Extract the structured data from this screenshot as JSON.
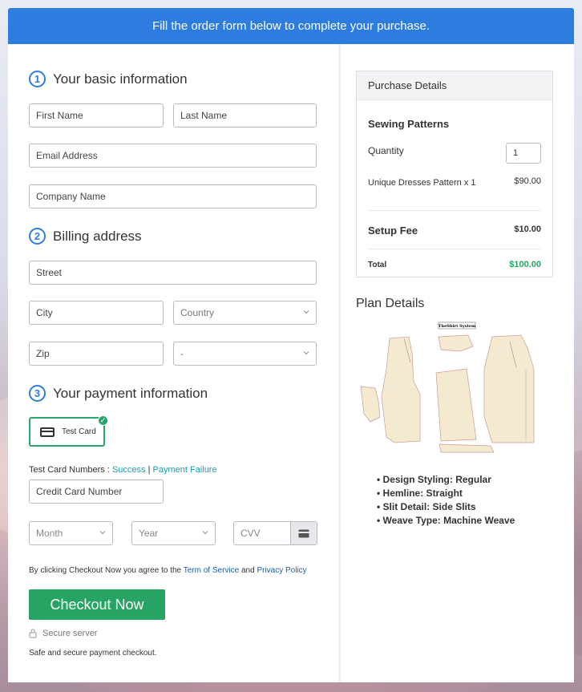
{
  "banner": "Fill the order form below to complete your purchase.",
  "sections": {
    "basic": {
      "num": "1",
      "title": "Your basic information"
    },
    "billing": {
      "num": "2",
      "title": "Billing address"
    },
    "payment": {
      "num": "3",
      "title": "Your payment information"
    }
  },
  "fields": {
    "first_name": "First Name",
    "last_name": "Last Name",
    "email": "Email Address",
    "company": "Company Name",
    "street": "Street",
    "city": "City",
    "country": "Country",
    "zip": "Zip",
    "state": "-",
    "card_number": "Credit Card Number",
    "month": "Month",
    "year": "Year",
    "cvv": "CVV"
  },
  "payment": {
    "test_card_label": "Test Card",
    "test_numbers_label": "Test Card Numbers :",
    "success_link": "Success",
    "separator": "|",
    "failure_link": "Payment Failure"
  },
  "terms": {
    "prefix": "By clicking Checkout Now you agree to the",
    "tos": "Term of Service",
    "and": "and",
    "privacy": "Privacy Policy"
  },
  "checkout_label": "Checkout Now",
  "secure_label": "Secure server",
  "safe_label": "Safe and secure payment checkout.",
  "purchase": {
    "header": "Purchase Details",
    "product": "Sewing Patterns",
    "quantity_label": "Quantity",
    "quantity_value": "1",
    "item_name": "Unique Dresses Pattern x 1",
    "item_price": "$90.00",
    "setup_label": "Setup Fee",
    "setup_price": "$10.00",
    "total_label": "Total",
    "total_price": "$100.00"
  },
  "plan": {
    "title": "Plan Details",
    "image_caption": "TheShirt System",
    "bullets": [
      "Design Styling: Regular",
      "Hemline: Straight",
      "Slit Detail: Side Slits",
      "Weave Type: Machine Weave"
    ]
  },
  "colors": {
    "banner": "#2d7de0",
    "accent": "#2d7de0",
    "checkout": "#27a463",
    "total": "#27a463",
    "link": "#1a9cb0"
  }
}
